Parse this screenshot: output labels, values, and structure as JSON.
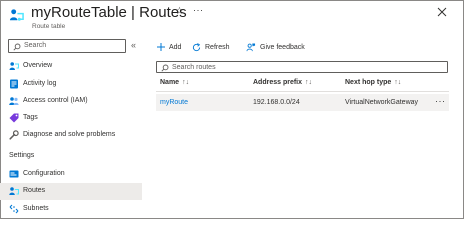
{
  "header": {
    "title": "myRouteTable | Routes",
    "subtitle": "Route table",
    "more": "···"
  },
  "sidebar": {
    "search_placeholder": "Search",
    "collapse": "«",
    "items": [
      {
        "label": "Overview",
        "icon": "overview-icon"
      },
      {
        "label": "Activity log",
        "icon": "activity-log-icon"
      },
      {
        "label": "Access control (IAM)",
        "icon": "access-control-icon"
      },
      {
        "label": "Tags",
        "icon": "tag-icon"
      },
      {
        "label": "Diagnose and solve problems",
        "icon": "wrench-icon"
      }
    ],
    "section_label": "Settings",
    "settings_items": [
      {
        "label": "Configuration",
        "icon": "configuration-icon"
      },
      {
        "label": "Routes",
        "icon": "routes-icon",
        "active": true
      },
      {
        "label": "Subnets",
        "icon": "subnets-icon"
      }
    ]
  },
  "toolbar": {
    "add_label": "Add",
    "refresh_label": "Refresh",
    "feedback_label": "Give feedback"
  },
  "main": {
    "search_placeholder": "Search routes",
    "columns": [
      "Name",
      "Address prefix",
      "Next hop type"
    ],
    "sort_glyph": "↑↓",
    "rows": [
      {
        "name": "myRoute",
        "address_prefix": "192.168.0.0/24",
        "next_hop_type": "VirtualNetworkGateway"
      }
    ],
    "row_more": "···"
  },
  "colors": {
    "accent": "#0078d4",
    "active_bg": "#edebe9",
    "row_bg": "#f3f2f1"
  }
}
